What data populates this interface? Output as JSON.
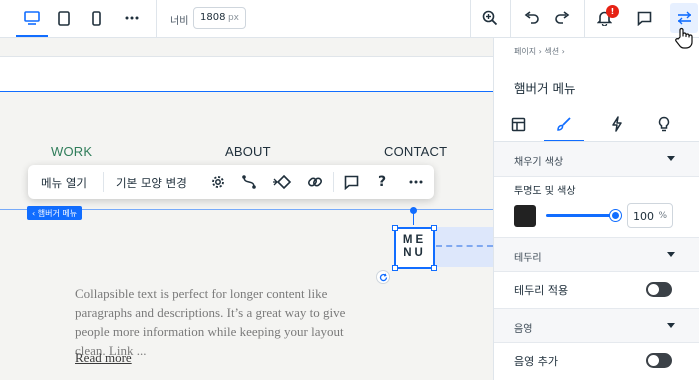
{
  "toolbar": {
    "width_label": "너비",
    "width_value": "1808",
    "width_unit": "px",
    "notification_count": "!"
  },
  "canvas": {
    "nav": [
      {
        "label": "WORK",
        "color": "#2f7d5a"
      },
      {
        "label": "ABOUT",
        "color": "#20303c"
      },
      {
        "label": "CONTACT",
        "color": "#20303c"
      }
    ],
    "element_tag": "‹ 햄버거 메뉴",
    "floating_toolbar": {
      "open_menu": "메뉴 열기",
      "change_layout": "기본 모양 변경",
      "help": "?"
    },
    "menu_button_label": "MENU",
    "paragraph": "Collapsible text is perfect for longer content like paragraphs and descriptions. It’s a great way to give people more information while keeping your layout clean. Link ...",
    "read_more": "Read more"
  },
  "panel": {
    "breadcrumb": "페이지  ›  섹션  ›",
    "title": "햄버거 메뉴",
    "fill_color": {
      "header": "채우기 색상",
      "opacity_label": "투명도 및 색상",
      "swatch_color": "#222222",
      "opacity_value": "100",
      "opacity_unit": "%",
      "opacity_fraction": 1.0
    },
    "border": {
      "header": "테두리",
      "apply_label": "테두리 적용",
      "apply_on": false
    },
    "shadow": {
      "header": "음영",
      "add_label": "음영 추가",
      "add_on": false
    }
  },
  "colors": {
    "accent": "#116dff",
    "canvas_bg": "#f4f4f2",
    "selection_highlight": "#dde7fb"
  }
}
